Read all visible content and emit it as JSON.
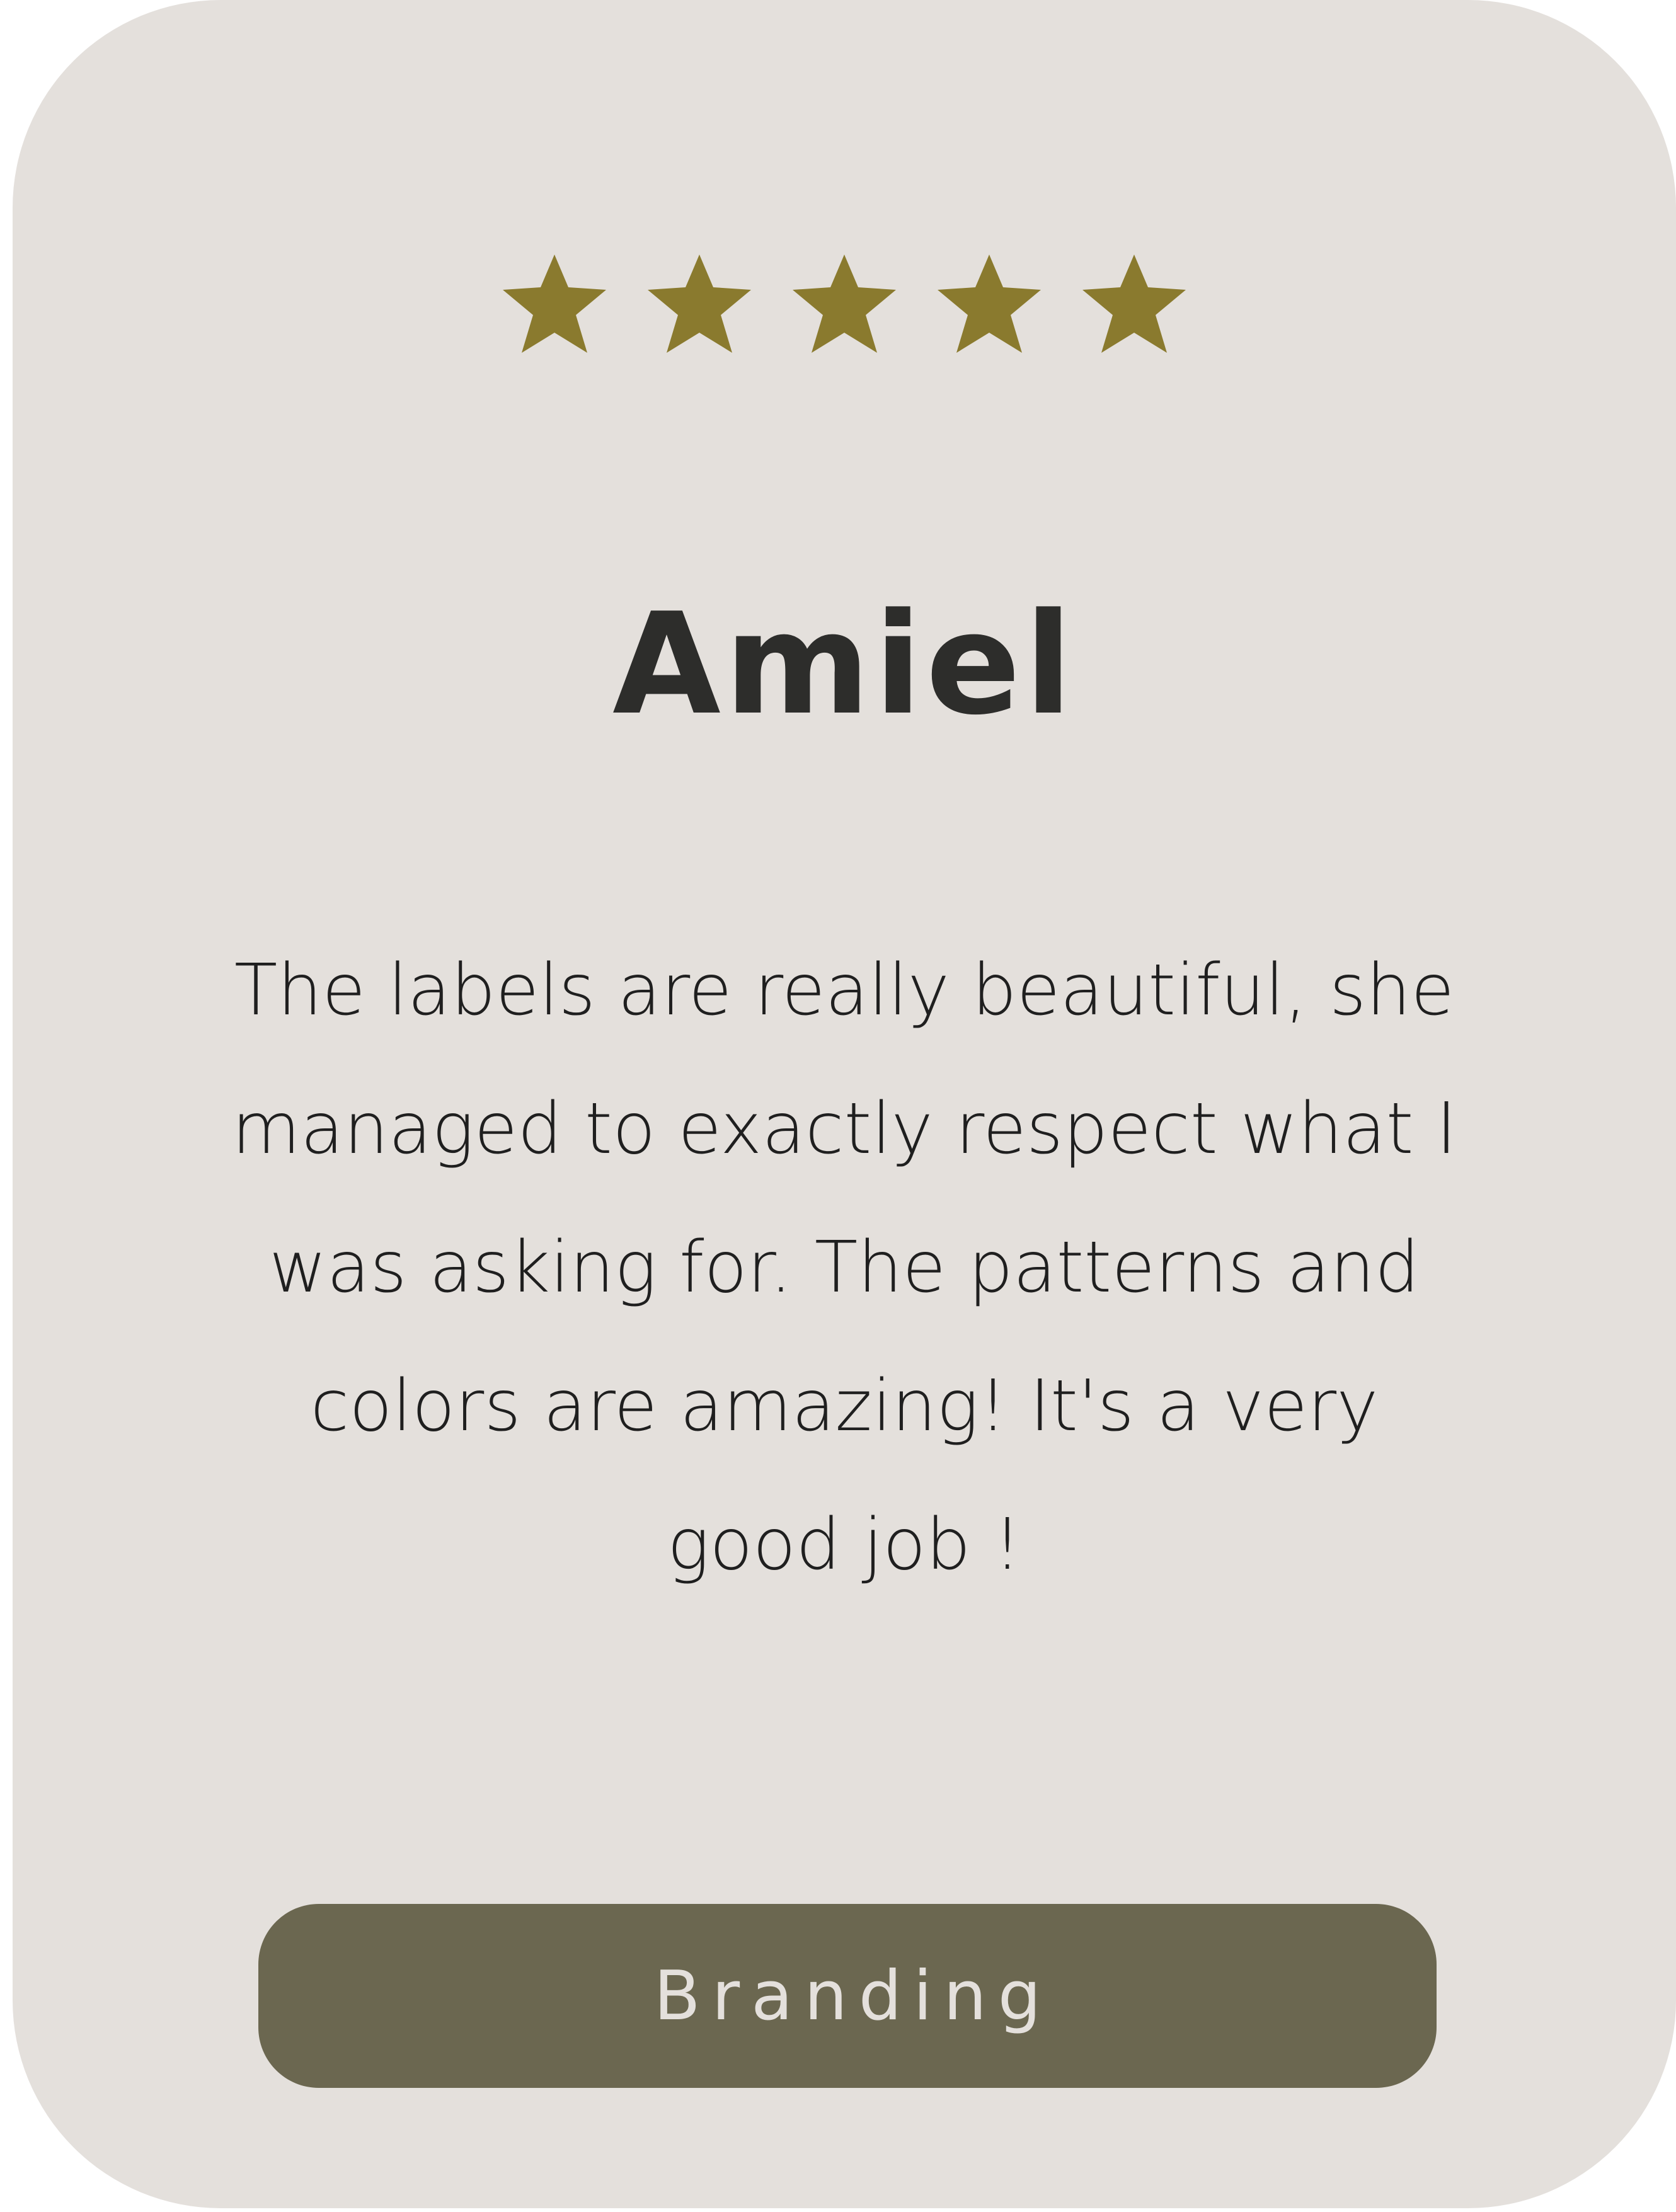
{
  "rating": {
    "stars": 5,
    "max": 5,
    "star_icon": "star-icon",
    "star_color": "#8a7a2e"
  },
  "reviewer": {
    "name": "Amiel"
  },
  "review": {
    "text": "The labels are really beautiful, she managed to exactly respect what I was asking for. The patterns and colors are amazing! It's a very good job !"
  },
  "tag": {
    "label": "Branding",
    "background": "#6b6750"
  },
  "colors": {
    "card_background": "#e4e0dc",
    "heading": "#2d2d2b",
    "body_text": "#1f1f1f"
  }
}
